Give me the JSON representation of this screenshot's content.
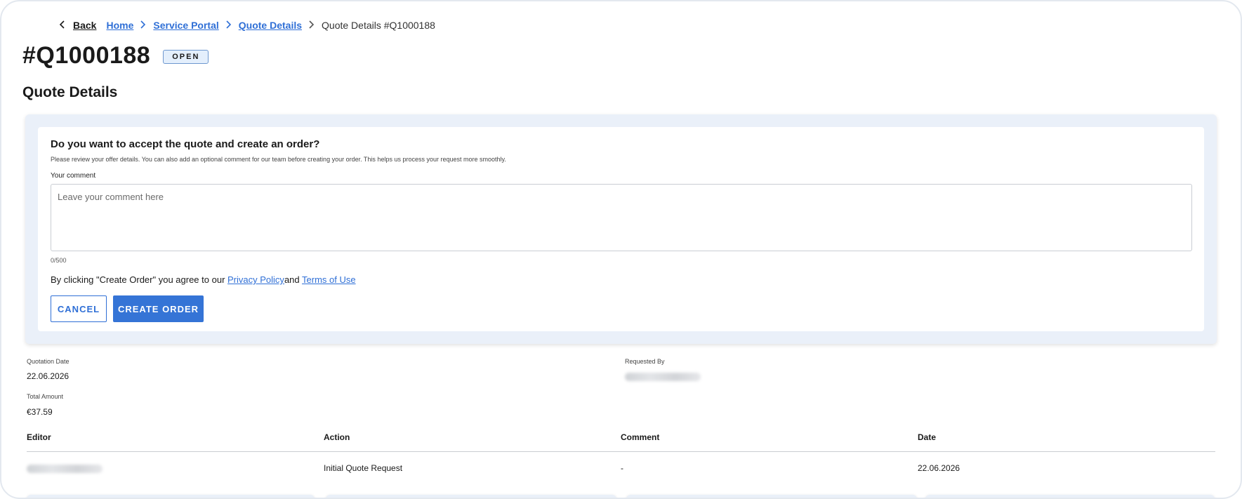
{
  "breadcrumb": {
    "back": "Back",
    "items": [
      "Home",
      "Service Portal",
      "Quote Details"
    ],
    "current": "Quote Details #Q1000188"
  },
  "quote": {
    "id": "#Q1000188",
    "status": "OPEN"
  },
  "section_title": "Quote Details",
  "accept_card": {
    "heading": "Do you want to accept the quote and create an order?",
    "description": "Please review your offer details. You can also add an optional comment for our team before creating your order. This helps us process your request more smoothly.",
    "comment_label": "Your comment",
    "comment_placeholder": "Leave your comment here",
    "comment_value": "",
    "char_count": "0/500",
    "agree_prefix": "By clicking \"Create Order\" you agree to our ",
    "privacy_link": "Privacy Policy",
    "agree_and": "and ",
    "terms_link": "Terms of Use",
    "cancel_label": "CANCEL",
    "create_label": "CREATE ORDER"
  },
  "info": {
    "quotation_date_label": "Quotation Date",
    "quotation_date": "22.06.2026",
    "requested_by_label": "Requested By",
    "total_amount_label": "Total Amount",
    "total_amount": "€37.59"
  },
  "history_table": {
    "columns": [
      "Editor",
      "Action",
      "Comment",
      "Date"
    ],
    "rows": [
      {
        "editor": "",
        "action": "Initial Quote Request",
        "comment": "-",
        "date": "22.06.2026"
      }
    ]
  },
  "colors": {
    "accent": "#3574d6",
    "link": "#2f6fd6",
    "card_bg": "#eaf0f9",
    "badge_bg": "#e4effc"
  }
}
